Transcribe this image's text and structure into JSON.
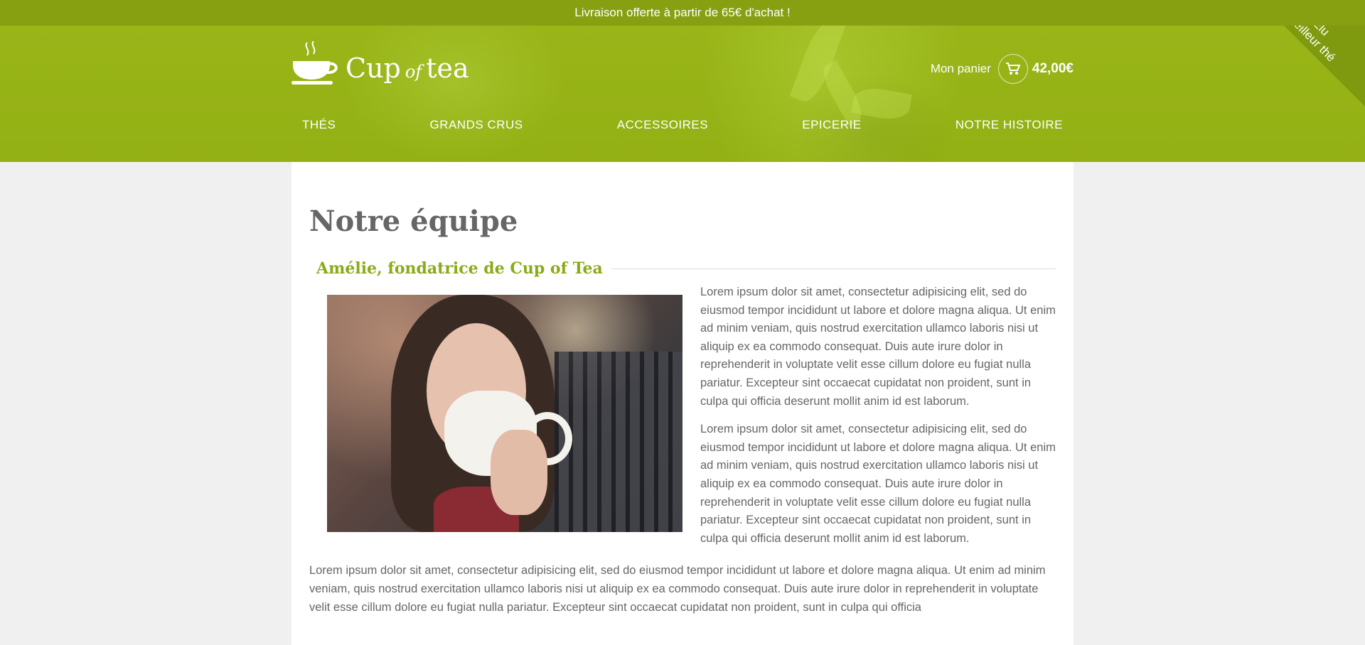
{
  "topbar": {
    "text": "Livraison offerte à partir de 65€ d'achat !"
  },
  "ribbon": {
    "line1": "Élu",
    "line2": "meilleur thé"
  },
  "logo": {
    "word1": "Cup",
    "word2": "of",
    "word3": "tea"
  },
  "cart": {
    "label": "Mon panier",
    "total": "42,00€"
  },
  "nav": [
    {
      "label": "Thés"
    },
    {
      "label": "Grands crus"
    },
    {
      "label": "Accessoires"
    },
    {
      "label": "Epicerie"
    },
    {
      "label": "Notre histoire"
    }
  ],
  "page": {
    "title": "Notre équipe"
  },
  "section": {
    "title": "Amélie, fondatrice de Cup of Tea",
    "paragraph1": "Lorem ipsum dolor sit amet, consectetur adipisicing elit, sed do eiusmod tempor incididunt ut labore et dolore magna aliqua. Ut enim ad minim veniam, quis nostrud exercitation ullamco laboris nisi ut aliquip ex ea commodo consequat. Duis aute irure dolor in reprehenderit in voluptate velit esse cillum dolore eu fugiat nulla pariatur. Excepteur sint occaecat cupidatat non proident, sunt in culpa qui officia deserunt mollit anim id est laborum.",
    "paragraph2": "Lorem ipsum dolor sit amet, consectetur adipisicing elit, sed do eiusmod tempor incididunt ut labore et dolore magna aliqua. Ut enim ad minim veniam, quis nostrud exercitation ullamco laboris nisi ut aliquip ex ea commodo consequat. Duis aute irure dolor in reprehenderit in voluptate velit esse cillum dolore eu fugiat nulla pariatur. Excepteur sint occaecat cupidatat non proident, sunt in culpa qui officia deserunt mollit anim id est laborum.",
    "paragraph3": "Lorem ipsum dolor sit amet, consectetur adipisicing elit, sed do eiusmod tempor incididunt ut labore et dolore magna aliqua. Ut enim ad minim veniam, quis nostrud exercitation ullamco laboris nisi ut aliquip ex ea commodo consequat. Duis aute irure dolor in reprehenderit in voluptate velit esse cillum dolore eu fugiat nulla pariatur. Excepteur sint occaecat cupidatat non proident, sunt in culpa qui officia"
  },
  "colors": {
    "brand": "#99b518",
    "accent": "#8aab17",
    "topbar": "#86a012"
  }
}
